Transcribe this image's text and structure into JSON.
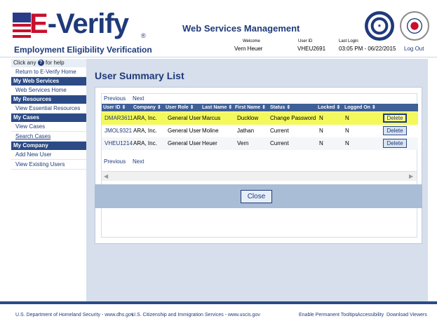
{
  "header": {
    "logo_text_e": "E",
    "logo_text_rest": "-Verify",
    "tagline": "Employment Eligibility Verification",
    "app_title": "Web Services Management",
    "welcome_label": "Welcome",
    "welcome_value": "Vern Heuer",
    "userid_label": "User ID",
    "userid_value": "VHEU2691",
    "lastlogin_label": "Last Login",
    "lastlogin_value": "03:05 PM - 06/22/2015",
    "logout_label": "Log Out"
  },
  "sidebar": {
    "help_prefix": "Click any",
    "help_suffix": "for help",
    "return_link": "Return to E-Verify Home",
    "sections": [
      {
        "title": "My Web Services",
        "links": [
          "Web Services Home"
        ]
      },
      {
        "title": "My Resources",
        "links": [
          "View Essential Resources"
        ]
      },
      {
        "title": "My Cases",
        "links": [
          "View Cases",
          "Search Cases"
        ]
      },
      {
        "title": "My Company",
        "links": [
          "Add New User",
          "View Existing Users"
        ]
      }
    ]
  },
  "main": {
    "page_title": "User Summary List",
    "pager": {
      "previous": "Previous",
      "next": "Next"
    },
    "columns": [
      "User ID",
      "Company",
      "User Role",
      "Last Name",
      "First Name",
      "Status",
      "Locked",
      "Logged On"
    ],
    "rows": [
      {
        "user_id": "DMAR3611",
        "company": "ARA, Inc.",
        "role": "General User",
        "last_name": "Marcus",
        "first_name": "Ducklow",
        "status": "Change Password",
        "locked": "N",
        "logged_on": "N",
        "action": "Delete"
      },
      {
        "user_id": "JMOL9321",
        "company": "ARA, Inc.",
        "role": "General User",
        "last_name": "Moline",
        "first_name": "Jathan",
        "status": "Current",
        "locked": "N",
        "logged_on": "N",
        "action": "Delete"
      },
      {
        "user_id": "VHEU1214",
        "company": "ARA, Inc.",
        "role": "General User",
        "last_name": "Heuer",
        "first_name": "Vern",
        "status": "Current",
        "locked": "N",
        "logged_on": "N",
        "action": "Delete"
      }
    ],
    "close_label": "Close"
  },
  "footer": {
    "dhs": "U.S. Department of Homeland Security - www.dhs.gov",
    "uscis": "U.S. Citizenship and Immigration Services - www.uscis.gov",
    "tooltips": "Enable Permanent Tooltips",
    "accessibility": "Accessibility",
    "viewers": "Download Viewers"
  },
  "colors": {
    "brand_blue": "#1f3a7a",
    "brand_red": "#c8102e",
    "highlight": "#f3f95a"
  }
}
